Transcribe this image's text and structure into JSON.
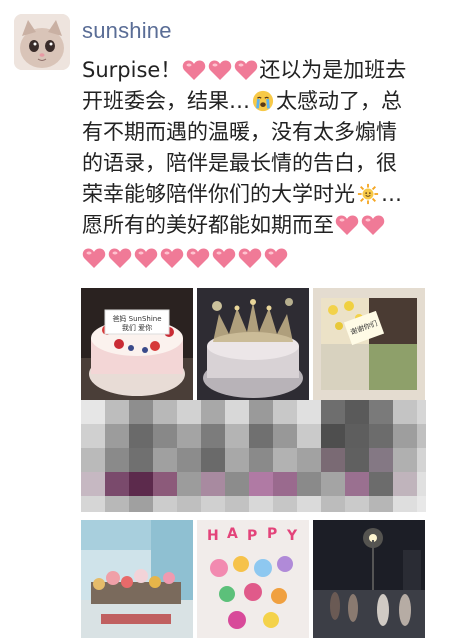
{
  "post": {
    "username": "sunshine",
    "line1_a": "Surpise！",
    "line1_b": "还以为是加班去",
    "line2_a": "开班委会，结果…",
    "line2_b": "太感动了，总",
    "line3": "有不期而遇的温暖，没有太多煽情",
    "line4": "的语录，陪伴是最长情的告白，很",
    "line5_a": "荣幸能够陪伴你们的大学时光",
    "line5_b": "…",
    "line6": "愿所有的美好都能如期而至"
  },
  "icons": {
    "avatar": "kitten-avatar-icon",
    "heart": "pink-heart-icon",
    "cry": "crying-face-icon",
    "sun": "sun-icon"
  },
  "photos": {
    "cake1_text_a": "爸妈 SunShine",
    "cake1_text_b": "我们 爱你",
    "sign_text": "谢谢你们",
    "balloon_letters": [
      "H",
      "A",
      "P",
      "P",
      "Y"
    ]
  },
  "colors": {
    "username": "#5a6d96",
    "heart": "#f07a97",
    "text": "#222222"
  }
}
